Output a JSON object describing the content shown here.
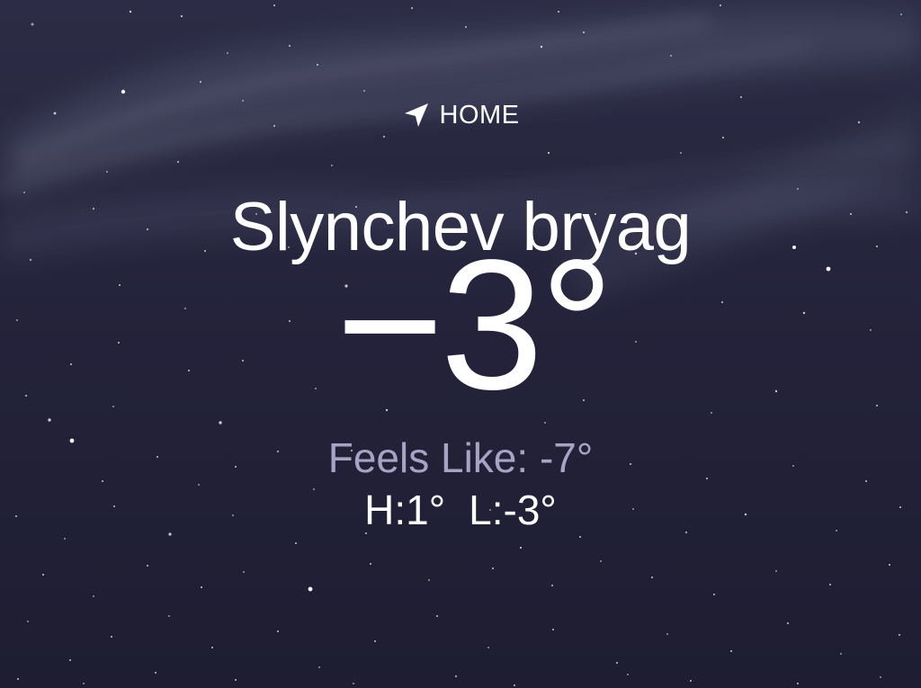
{
  "background": {
    "sky_top": "#2c2c46",
    "sky_bottom": "#1f1e34",
    "star_color": "#ffffff",
    "cloud_color": "#8f93b3"
  },
  "location": {
    "icon": "location-arrow-icon",
    "label": "HOME"
  },
  "city": "Slynchev bryag",
  "current": {
    "temperature": "−3°",
    "feels_like": "Feels Like: -7°",
    "high": "H:1°",
    "low": "L:-3°"
  }
}
